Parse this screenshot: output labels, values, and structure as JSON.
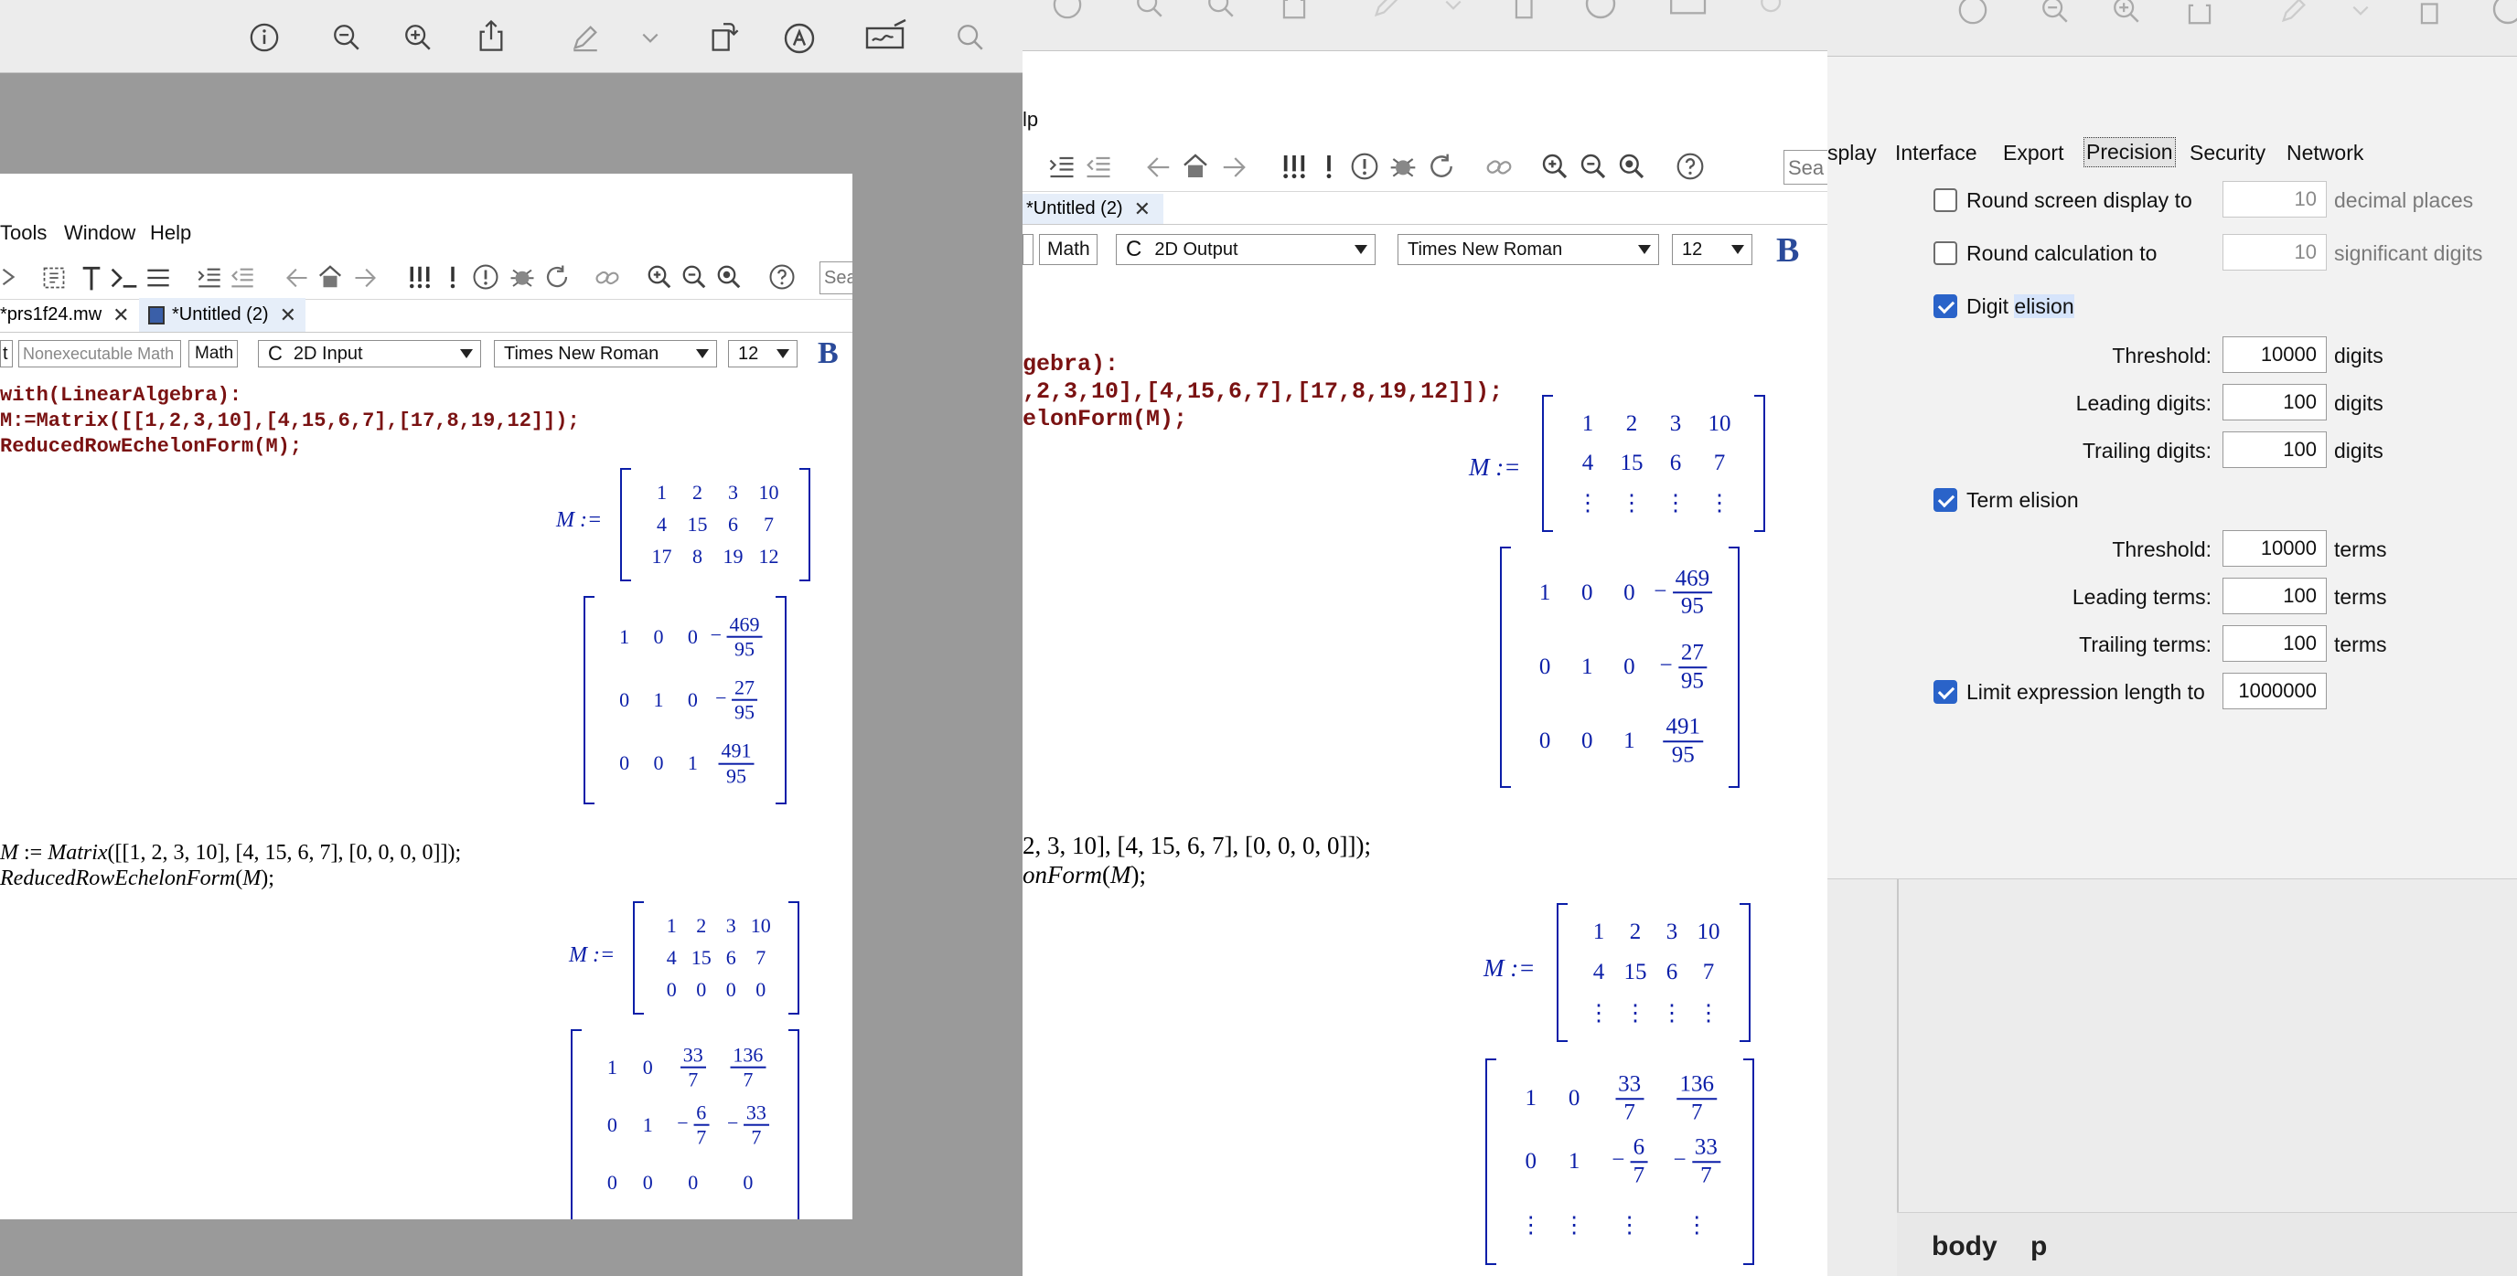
{
  "left_window": {
    "menu": [
      "Tools",
      "Window",
      "Help"
    ],
    "tabs": [
      {
        "label": "*prs1f24.mw",
        "close": "✕"
      },
      {
        "label": "*Untitled (2)",
        "close": "✕"
      }
    ],
    "context": {
      "first": "t",
      "nonexec_placeholder": "Nonexecutable Math",
      "math_button": "Math",
      "mode": "2D Input",
      "font": "Times New Roman",
      "size": "12",
      "bold": "B"
    },
    "search_partial": "Sea",
    "code_lines": [
      "with(LinearAlgebra):",
      "M:=Matrix([[1,2,3,10],[4,15,6,7],[17,8,19,12]]);",
      "ReducedRowEchelonForm(M);"
    ],
    "input2_line1_prefix": "M",
    "input2_line1_assign": " := ",
    "input2_line1_func": "Matrix",
    "input2_line1_args": "([[1, 2, 3, 10], [4, 15, 6, 7], [0, 0, 0, 0]]);",
    "input2_line2_func": "ReducedRowEchelonForm",
    "input2_line2_open": "(",
    "input2_line2_arg": "M",
    "input2_line2_close": ");"
  },
  "right_window": {
    "menu_partial": "lp",
    "tab": {
      "label": "*Untitled (2)",
      "close": "✕"
    },
    "context": {
      "math_button": "Math",
      "mode": "2D Output",
      "font": "Times New Roman",
      "size": "12",
      "bold": "B"
    },
    "search_partial": "Sea",
    "code_lines": [
      "gebra):",
      ",2,3,10],[4,15,6,7],[17,8,19,12]]);",
      "elonForm(M);"
    ],
    "input2_line1": "2, 3, 10], [4, 15, 6, 7], [0, 0, 0, 0]]);",
    "input2_line2_func": "onForm",
    "input2_line2_open": "(",
    "input2_line2_arg": "M",
    "input2_line2_close": ");",
    "status_body": "body",
    "status_p": "p"
  },
  "output": {
    "assign_label": "M :=",
    "matrix1": [
      [
        "1",
        "2",
        "3",
        "10"
      ],
      [
        "4",
        "15",
        "6",
        "7"
      ],
      [
        "17",
        "8",
        "19",
        "12"
      ]
    ],
    "matrix1_elided": [
      [
        "1",
        "2",
        "3",
        "10"
      ],
      [
        "4",
        "15",
        "6",
        "7"
      ],
      [
        "⋮",
        "⋮",
        "⋮",
        "⋮"
      ]
    ],
    "rref1": [
      [
        "1",
        "0",
        "0",
        {
          "sign": "−",
          "num": "469",
          "den": "95"
        }
      ],
      [
        "0",
        "1",
        "0",
        {
          "sign": "−",
          "num": "27",
          "den": "95"
        }
      ],
      [
        "0",
        "0",
        "1",
        {
          "sign": "",
          "num": "491",
          "den": "95"
        }
      ]
    ],
    "matrix2": [
      [
        "1",
        "2",
        "3",
        "10"
      ],
      [
        "4",
        "15",
        "6",
        "7"
      ],
      [
        "0",
        "0",
        "0",
        "0"
      ]
    ],
    "matrix2_elided": [
      [
        "1",
        "2",
        "3",
        "10"
      ],
      [
        "4",
        "15",
        "6",
        "7"
      ],
      [
        "⋮",
        "⋮",
        "⋮",
        "⋮"
      ]
    ],
    "rref2": [
      [
        "1",
        "0",
        {
          "sign": "",
          "num": "33",
          "den": "7"
        },
        {
          "sign": "",
          "num": "136",
          "den": "7"
        }
      ],
      [
        "0",
        "1",
        {
          "sign": "−",
          "num": "6",
          "den": "7"
        },
        {
          "sign": "−",
          "num": "33",
          "den": "7"
        }
      ],
      [
        "0",
        "0",
        "0",
        "0"
      ]
    ],
    "rref2_elided_row": [
      "⋮",
      "⋮",
      "⋮",
      "⋮"
    ]
  },
  "preferences": {
    "tabs": [
      "splay",
      "Interface",
      "Export",
      "Precision",
      "Security",
      "Network"
    ],
    "active_tab": "Precision",
    "round_display": {
      "label": "Round screen display to",
      "value": "10",
      "unit": "decimal places",
      "checked": false
    },
    "round_calc": {
      "label": "Round calculation to",
      "value": "10",
      "unit": "significant digits",
      "checked": false
    },
    "digit_elision": {
      "label_a": "Digit ",
      "label_b": "elision",
      "checked": true
    },
    "digit_threshold": {
      "label": "Threshold:",
      "value": "10000",
      "unit": "digits"
    },
    "leading_digits": {
      "label": "Leading digits:",
      "value": "100",
      "unit": "digits"
    },
    "trailing_digits": {
      "label": "Trailing digits:",
      "value": "100",
      "unit": "digits"
    },
    "term_elision": {
      "label": "Term elision",
      "checked": true
    },
    "term_threshold": {
      "label": "Threshold:",
      "value": "10000",
      "unit": "terms"
    },
    "leading_terms": {
      "label": "Leading terms:",
      "value": "100",
      "unit": "terms"
    },
    "trailing_terms": {
      "label": "Trailing terms:",
      "value": "100",
      "unit": "terms"
    },
    "limit_length": {
      "label": "Limit expression length to",
      "value": "1000000",
      "checked": true
    }
  },
  "colors": {
    "math_blue": "#0b1ea8",
    "code_maroon": "#7a1212",
    "checkbox_blue": "#2a63c9"
  }
}
